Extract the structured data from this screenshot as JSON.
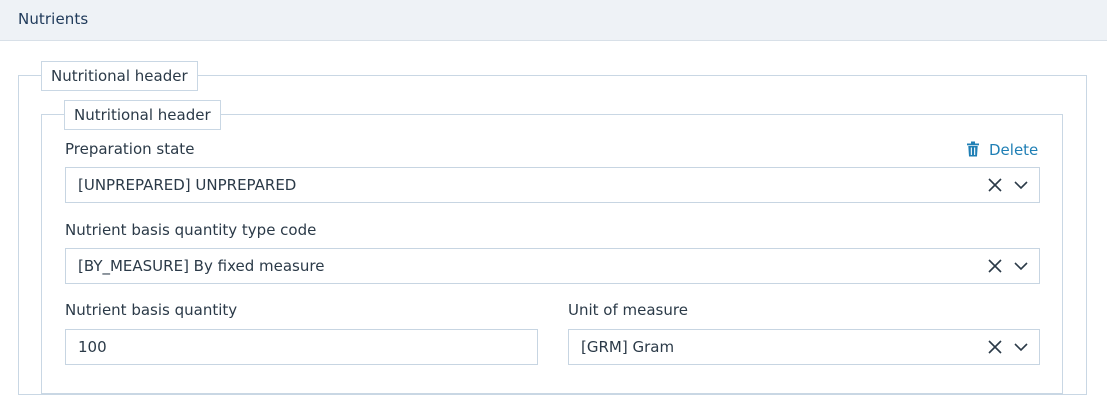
{
  "section": {
    "title": "Nutrients"
  },
  "outer_fieldset": {
    "legend": "Nutritional header"
  },
  "inner_fieldset": {
    "legend": "Nutritional header",
    "delete_label": "Delete",
    "preparation_state": {
      "label": "Preparation state",
      "value": "[UNPREPARED] UNPREPARED"
    },
    "basis_quantity_type": {
      "label": "Nutrient basis quantity type code",
      "value": "[BY_MEASURE] By fixed measure"
    },
    "basis_quantity": {
      "label": "Nutrient basis quantity",
      "value": "100"
    },
    "unit_of_measure": {
      "label": "Unit of measure",
      "value": "[GRM] Gram"
    }
  },
  "icons": {
    "delete": "trash-icon",
    "clear": "close-icon",
    "dropdown": "chevron-down-icon"
  },
  "colors": {
    "header_bg": "#eef2f6",
    "link": "#1f7fb5",
    "border": "#c7d5e2",
    "text": "#2b3a48"
  }
}
